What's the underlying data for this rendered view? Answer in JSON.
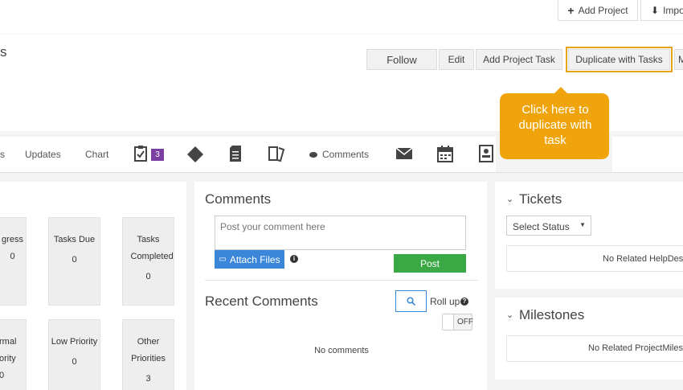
{
  "topbar": {
    "add_project_label": "Add Project",
    "import_label": "Impo"
  },
  "header": {
    "title_fragment": "s",
    "follow_label": "Follow",
    "edit_label": "Edit",
    "add_task_label": "Add Project Task",
    "duplicate_label": "Duplicate with Tasks",
    "more_label": "M"
  },
  "callout": {
    "text": "Click here to duplicate with task",
    "color": "#f0a40b"
  },
  "tabs": {
    "partial_label": "s",
    "updates_label": "Updates",
    "chart_label": "Chart",
    "tasks_badge": "3",
    "comments_label": "Comments"
  },
  "stats": [
    {
      "label": "gress",
      "value": "0"
    },
    {
      "label": "Tasks Due",
      "value": "0"
    },
    {
      "label": "Tasks Completed",
      "value": "0"
    },
    {
      "label": "rmal ority",
      "value": "0"
    },
    {
      "label": "Low Priority",
      "value": "0"
    },
    {
      "label": "Other Priorities",
      "value": "3"
    }
  ],
  "comments": {
    "title": "Comments",
    "placeholder": "Post your comment here",
    "attach_label": "Attach Files",
    "post_label": "Post",
    "recent_title": "Recent Comments",
    "rollup_label": "Roll up",
    "toggle_label": "OFF",
    "empty_text": "No comments"
  },
  "tickets": {
    "title": "Tickets",
    "select_value": "Select Status",
    "empty_text": "No Related HelpDesk"
  },
  "milestones": {
    "title": "Milestones",
    "empty_text": "No Related ProjectMilest"
  },
  "colors": {
    "accent_blue": "#3a86d8",
    "post_green": "#3aa845",
    "badge_purple": "#7b3fa3",
    "highlight_border": "#e8a317"
  }
}
